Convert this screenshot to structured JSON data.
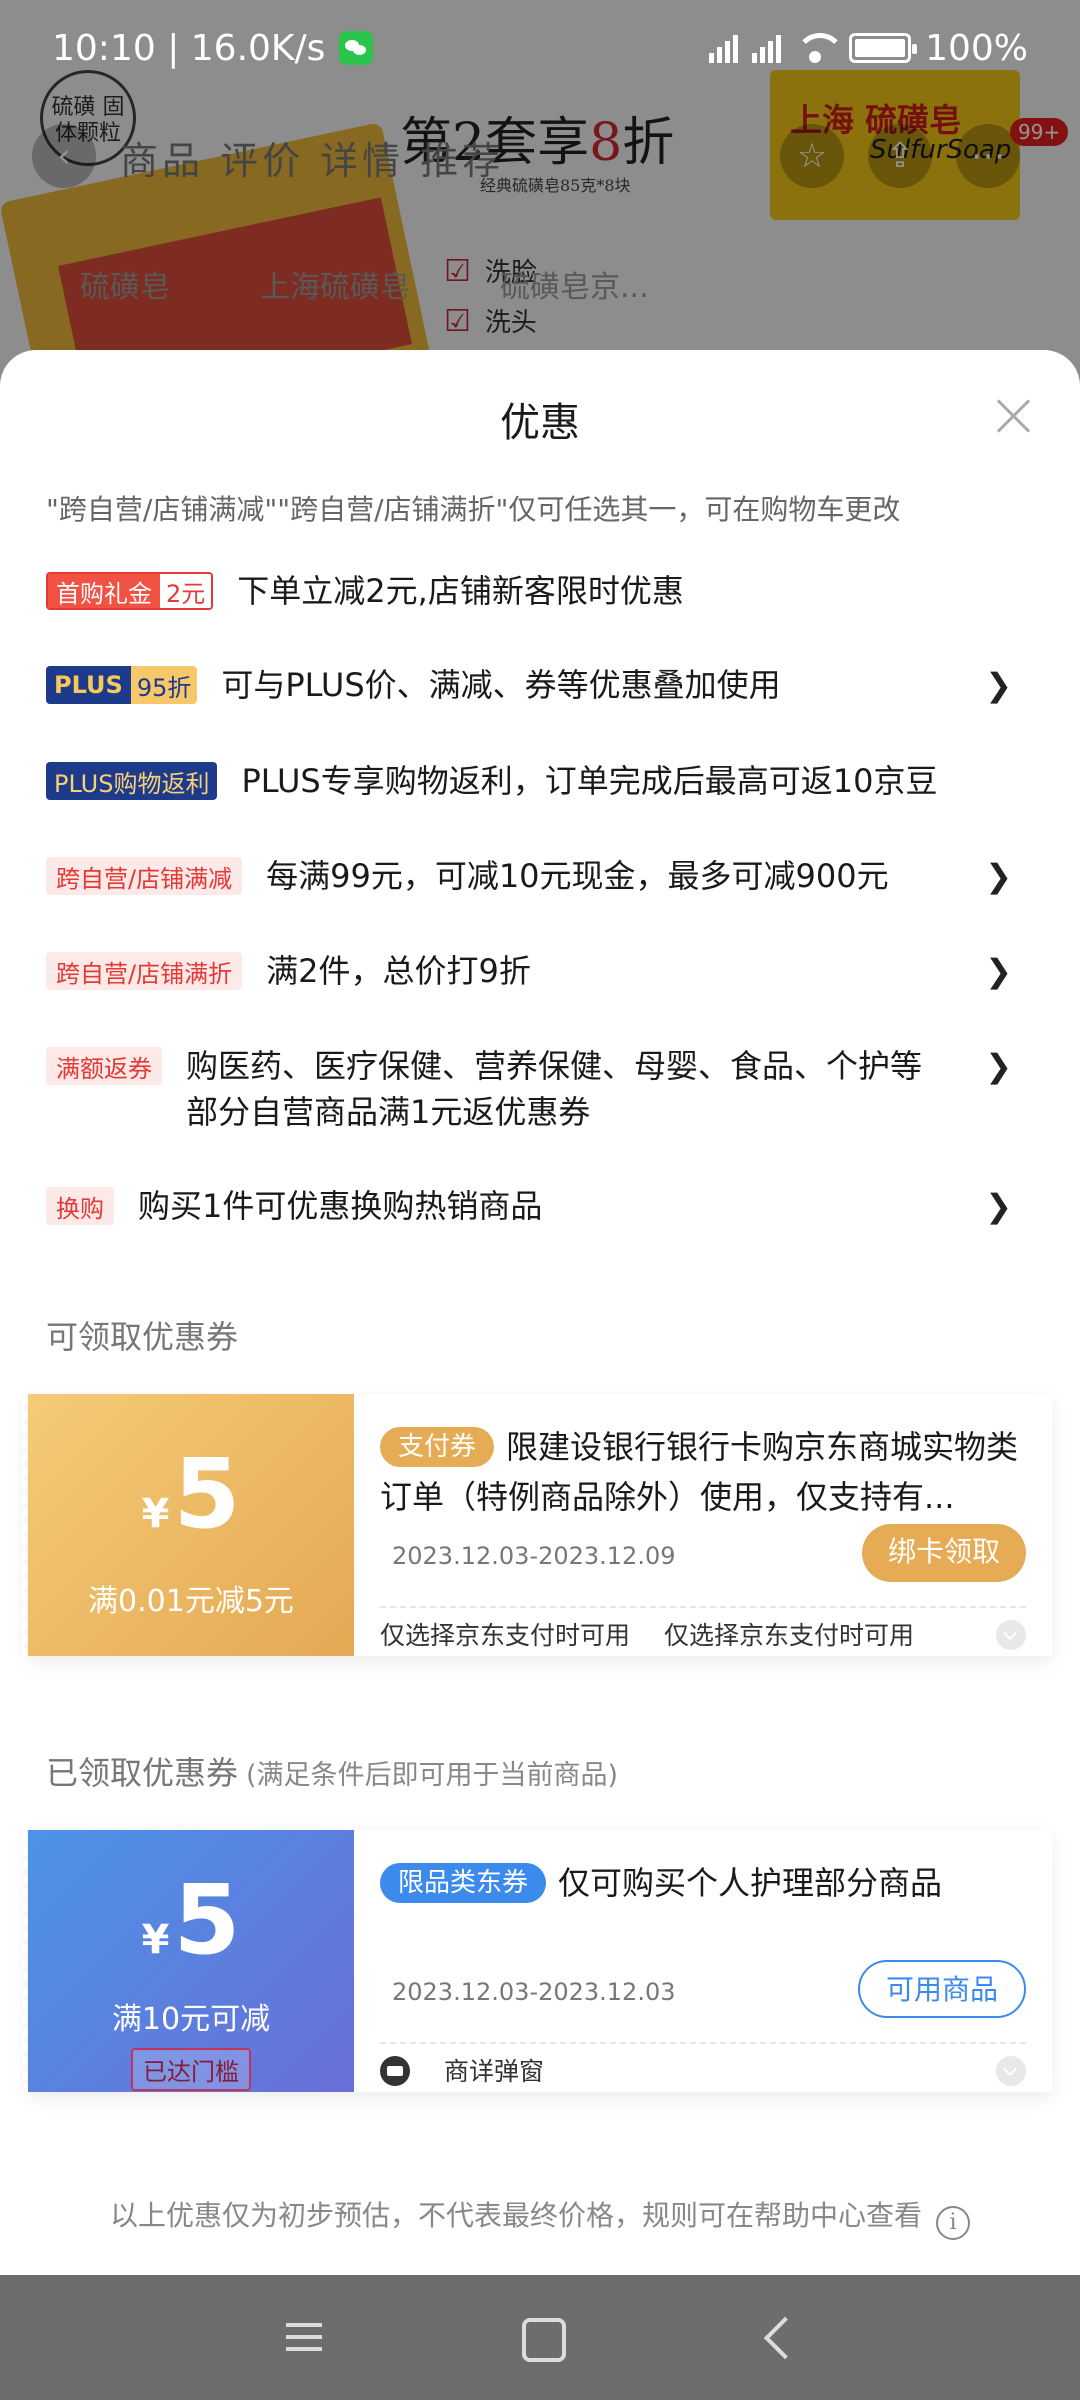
{
  "status_bar": {
    "time_speed": "10:10 | 16.0K/s",
    "battery": "100%"
  },
  "background": {
    "logo_text": "硫磺 固体颗粒",
    "promo_title_prefix": "第2套享",
    "promo_title_number": "8",
    "promo_title_suffix": "折",
    "promo_subtitle": "经典硫磺皂85克*8块",
    "nav_tabs": "商品  评价  详情  推荐",
    "soap_brand": "上海 硫磺皂",
    "soap_sub": "SulfurSoap",
    "cart_badge": "99+",
    "check_1": "洗脸",
    "check_2": "洗头",
    "search_chips": [
      "硫磺皂",
      "上海硫磺皂",
      "硫磺皂京..."
    ]
  },
  "sheet": {
    "title": "优惠",
    "notice": "\"跨自营/店铺满减\"\"跨自营/店铺满折\"仅可任选其一，可在购物车更改",
    "promotions": [
      {
        "tag_a": "首购礼金",
        "tag_b": "2元",
        "text": "下单立减2元,店铺新客限时优惠",
        "arrow": ""
      },
      {
        "tag_a": "PLUS",
        "tag_b": "95折",
        "text": "可与PLUS价、满减、券等优惠叠加使用",
        "arrow": "❯"
      },
      {
        "tag": "PLUS购物返利",
        "text": "PLUS专享购物返利，订单完成后最高可返10京豆",
        "arrow": ""
      },
      {
        "tag": "跨自营/店铺满减",
        "text": "每满99元，可减10元现金，最多可减900元",
        "arrow": "❯"
      },
      {
        "tag": "跨自营/店铺满折",
        "text": "满2件，总价打9折",
        "arrow": "❯"
      },
      {
        "tag": "满额返券",
        "text": "购医药、医疗保健、营养保健、母婴、食品、个护等部分自营商品满1元返优惠券",
        "arrow": "❯"
      },
      {
        "tag": "换购",
        "text": "购买1件可优惠换购热销商品",
        "arrow": "❯"
      }
    ],
    "available_section": "可领取优惠券",
    "claimed_section": "已领取优惠券",
    "claimed_section_sub": "(满足条件后即可用于当前商品)",
    "coupon_available": {
      "currency": "¥",
      "amount": "5",
      "condition": "满0.01元减5元",
      "tag": "支付券",
      "title": "限建设银行银行卡购京东商城实物类订单（特例商品除外）使用，仅支持有...",
      "date": "2023.12.03-2023.12.09",
      "button": "绑卡领取",
      "foot_1": "仅选择京东支付时可用",
      "foot_2": "仅选择京东支付时可用"
    },
    "coupon_claimed": {
      "currency": "¥",
      "amount": "5",
      "condition": "满10元可减",
      "reached": "已达门槛",
      "tag": "限品类东券",
      "title": "仅可购买个人护理部分商品",
      "date": "2023.12.03-2023.12.03",
      "button": "可用商品",
      "foot": "商详弹窗"
    },
    "footnote": "以上优惠仅为初步预估，不代表最终价格，规则可在帮助中心查看",
    "info_glyph": "i"
  },
  "colors": {
    "accent_red": "#e53935",
    "plus_blue": "#1e3a8a",
    "coupon_gold": "#e6ab55",
    "coupon_blue": "#3c8bec"
  }
}
